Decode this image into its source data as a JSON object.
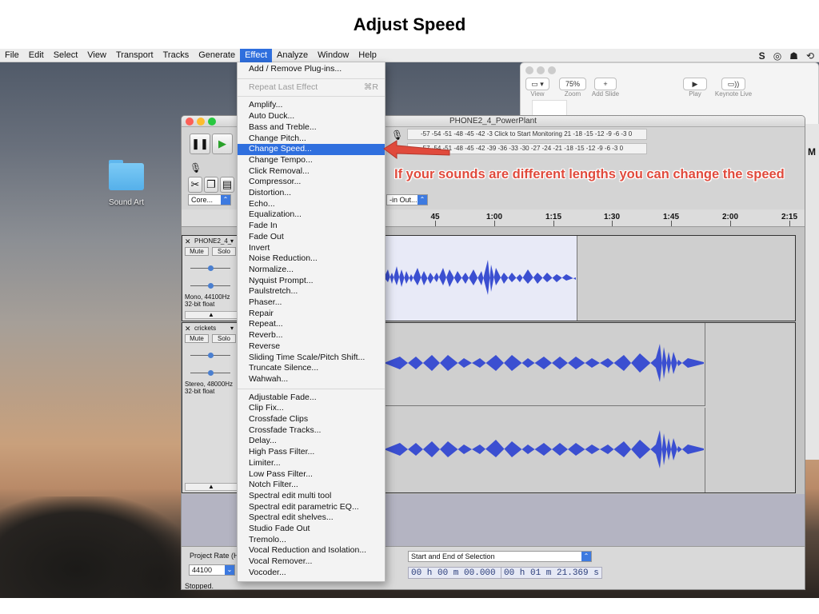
{
  "slide": {
    "title": "Adjust Speed"
  },
  "menubar": {
    "items": [
      "File",
      "Edit",
      "Select",
      "View",
      "Transport",
      "Tracks",
      "Generate",
      "Effect",
      "Analyze",
      "Window",
      "Help"
    ],
    "active": "Effect"
  },
  "status_icons": [
    "S",
    "◎",
    "☗",
    "⟲"
  ],
  "desktop": {
    "folder_label": "Sound Art"
  },
  "keynote": {
    "zoom_value": "75%",
    "view_label": "View",
    "zoom_label": "Zoom",
    "add_slide_label": "Add Slide",
    "play_label": "Play",
    "keynote_live_label": "Keynote Live"
  },
  "audacity": {
    "window_title": "PHONE2_4_PowerPlant",
    "monitor_label": "Click to Start Monitoring",
    "meter_ticks_top": "-57 -54 -51 -48 -45 -42 -3",
    "meter_ticks_top_right": "21 -18 -15 -12 -9 -6 -3 0",
    "meter_ticks_bottom": "-57 -54 -51 -48 -45 -42 -39 -36 -33 -30 -27 -24 -21 -18 -15 -12 -9 -6 -3 0",
    "host_label": "Core...",
    "device_label": "-in Out...",
    "timeline_ticks": [
      "45",
      "1:00",
      "1:15",
      "1:30",
      "1:45",
      "2:00",
      "2:15"
    ],
    "tracks": [
      {
        "name": "PHONE2_4_",
        "mute": "Mute",
        "solo": "Solo",
        "info1": "Mono, 44100Hz",
        "info2": "32-bit float"
      },
      {
        "name": "crickets",
        "mute": "Mute",
        "solo": "Solo",
        "info1": "Stereo, 48000Hz",
        "info2": "32-bit float"
      }
    ],
    "project_rate_label": "Project Rate (Hz",
    "project_rate_value": "44100",
    "selection_mode": "Start and End of Selection",
    "sel_start": "00 h 00 m 00.000 s",
    "sel_end": "00 h 01 m 21.369 s",
    "status": "Stopped."
  },
  "effect_menu": {
    "items": [
      {
        "label": "Add / Remove Plug-ins..."
      },
      {
        "sep": true
      },
      {
        "label": "Repeat Last Effect",
        "shortcut": "⌘R",
        "disabled": true
      },
      {
        "sep": true
      },
      {
        "label": "Amplify..."
      },
      {
        "label": "Auto Duck..."
      },
      {
        "label": "Bass and Treble..."
      },
      {
        "label": "Change Pitch..."
      },
      {
        "label": "Change Speed...",
        "selected": true
      },
      {
        "label": "Change Tempo..."
      },
      {
        "label": "Click Removal..."
      },
      {
        "label": "Compressor..."
      },
      {
        "label": "Distortion..."
      },
      {
        "label": "Echo..."
      },
      {
        "label": "Equalization..."
      },
      {
        "label": "Fade In"
      },
      {
        "label": "Fade Out"
      },
      {
        "label": "Invert"
      },
      {
        "label": "Noise Reduction..."
      },
      {
        "label": "Normalize..."
      },
      {
        "label": "Nyquist Prompt..."
      },
      {
        "label": "Paulstretch..."
      },
      {
        "label": "Phaser..."
      },
      {
        "label": "Repair"
      },
      {
        "label": "Repeat..."
      },
      {
        "label": "Reverb..."
      },
      {
        "label": "Reverse"
      },
      {
        "label": "Sliding Time Scale/Pitch Shift..."
      },
      {
        "label": "Truncate Silence..."
      },
      {
        "label": "Wahwah..."
      },
      {
        "sep": true
      },
      {
        "label": "Adjustable Fade..."
      },
      {
        "label": "Clip Fix..."
      },
      {
        "label": "Crossfade Clips"
      },
      {
        "label": "Crossfade Tracks..."
      },
      {
        "label": "Delay..."
      },
      {
        "label": "High Pass Filter..."
      },
      {
        "label": "Limiter..."
      },
      {
        "label": "Low Pass Filter..."
      },
      {
        "label": "Notch Filter..."
      },
      {
        "label": "Spectral edit multi tool"
      },
      {
        "label": "Spectral edit parametric EQ..."
      },
      {
        "label": "Spectral edit shelves..."
      },
      {
        "label": "Studio Fade Out"
      },
      {
        "label": "Tremolo..."
      },
      {
        "label": "Vocal Reduction and Isolation..."
      },
      {
        "label": "Vocal Remover..."
      },
      {
        "label": "Vocoder..."
      }
    ]
  },
  "annotation": {
    "text": "If your sounds are different lengths you can change the speed",
    "color": "#e04a3c"
  },
  "colors": {
    "accent": "#2f6fde",
    "waveform": "#3b4fd1"
  }
}
